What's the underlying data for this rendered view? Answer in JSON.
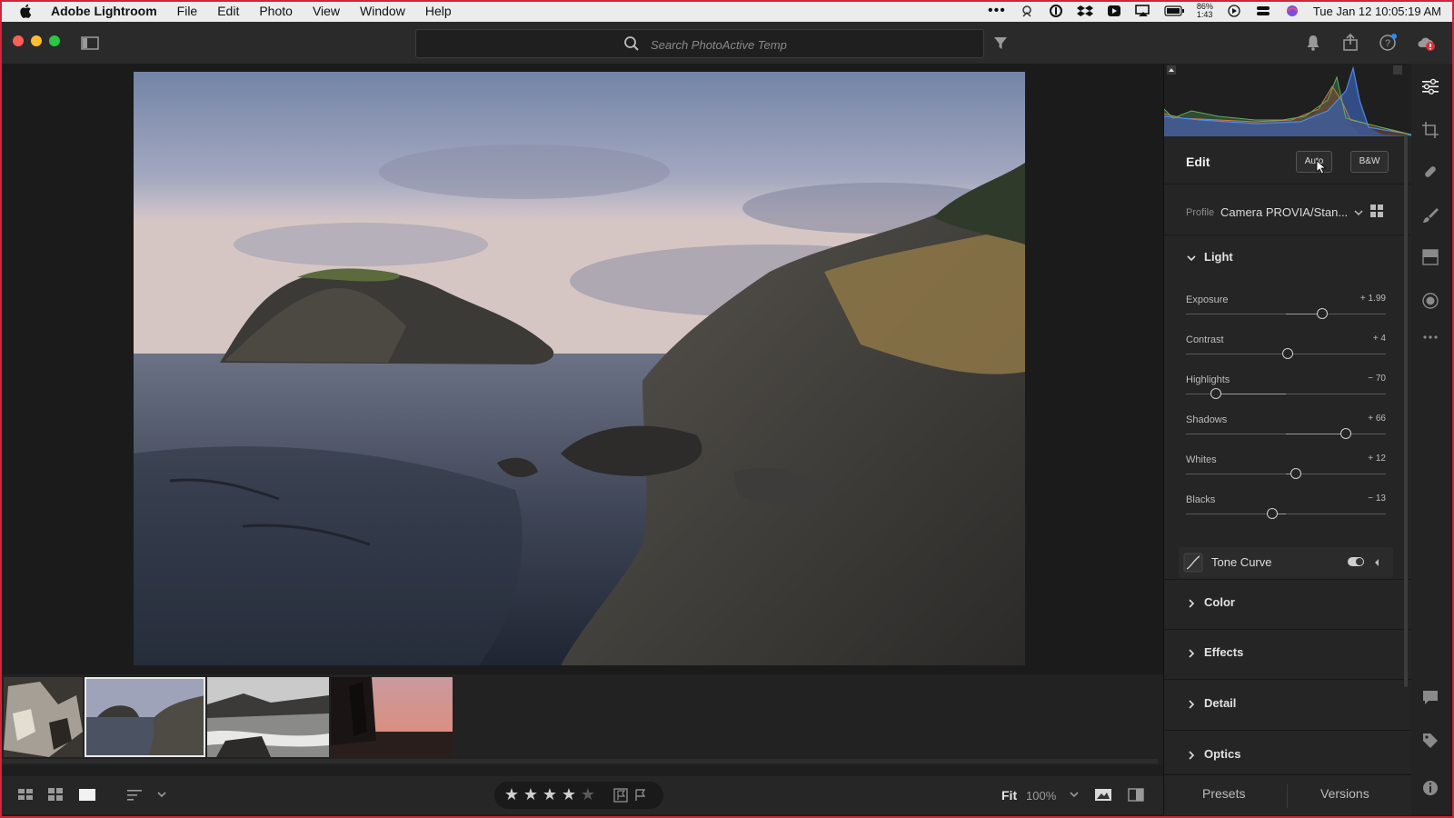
{
  "menubar": {
    "app_name": "Adobe Lightroom",
    "menus": [
      "File",
      "Edit",
      "Photo",
      "View",
      "Window",
      "Help"
    ],
    "battery_percent": "86%",
    "battery_time": "1:43",
    "clock": "Tue Jan 12  10:05:19 AM"
  },
  "toolbar": {
    "search_placeholder": "Search PhotoActive Temp"
  },
  "edit_panel": {
    "title": "Edit",
    "auto_label": "Auto",
    "bw_label": "B&W",
    "profile_label": "Profile",
    "profile_value": "Camera PROVIA/Stan...",
    "light_section": "Light",
    "sliders": [
      {
        "name": "Exposure",
        "value": "+ 1.99",
        "position": 0.68
      },
      {
        "name": "Contrast",
        "value": "+ 4",
        "position": 0.51
      },
      {
        "name": "Highlights",
        "value": "− 70",
        "position": 0.15
      },
      {
        "name": "Shadows",
        "value": "+ 66",
        "position": 0.8
      },
      {
        "name": "Whites",
        "value": "+ 12",
        "position": 0.55
      },
      {
        "name": "Blacks",
        "value": "− 13",
        "position": 0.43
      }
    ],
    "tone_curve": "Tone Curve",
    "sections": [
      "Color",
      "Effects",
      "Detail",
      "Optics"
    ]
  },
  "bottom": {
    "fit_label": "Fit",
    "zoom_level": "100%",
    "rating": 4
  },
  "panel_tabs": {
    "presets": "Presets",
    "versions": "Versions"
  },
  "colors": {
    "accent": "#cfcfcf",
    "alert_red": "#e0303a",
    "notify_blue": "#2d8cf0"
  }
}
